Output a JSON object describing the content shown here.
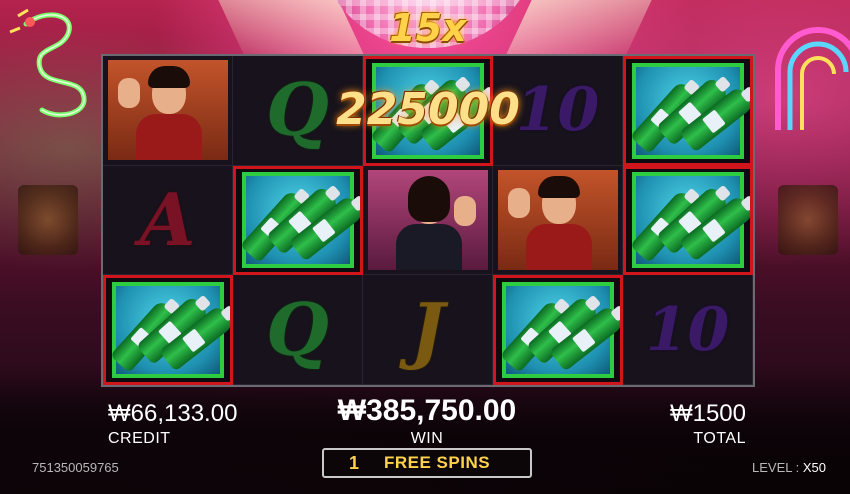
{
  "game": {
    "multiplier": "15x",
    "win_popup": "225000"
  },
  "reels": [
    [
      "man",
      "Q",
      "bottles",
      "10",
      "bottles"
    ],
    [
      "A",
      "bottles",
      "woman",
      "man",
      "bottles"
    ],
    [
      "bottles",
      "Q",
      "J",
      "bottles",
      "10"
    ]
  ],
  "winning_cells": [
    [
      0,
      2
    ],
    [
      0,
      4
    ],
    [
      1,
      1
    ],
    [
      1,
      4
    ],
    [
      2,
      0
    ],
    [
      2,
      3
    ]
  ],
  "hud": {
    "credit_value": "₩66,133.00",
    "credit_label": "CREDIT",
    "win_value": "₩385,750.00",
    "win_label": "WIN",
    "total_value": "₩1500",
    "total_label": "TOTAL",
    "free_spins_count": "1",
    "free_spins_label": "FREE SPINS"
  },
  "footer": {
    "game_id": "751350059765",
    "level_label": "LEVEL : ",
    "level_value": "X50"
  },
  "colors": {
    "win_border": "#d1151c",
    "gold_text": "#ffd24a",
    "tile_border": "#2ecc40"
  }
}
